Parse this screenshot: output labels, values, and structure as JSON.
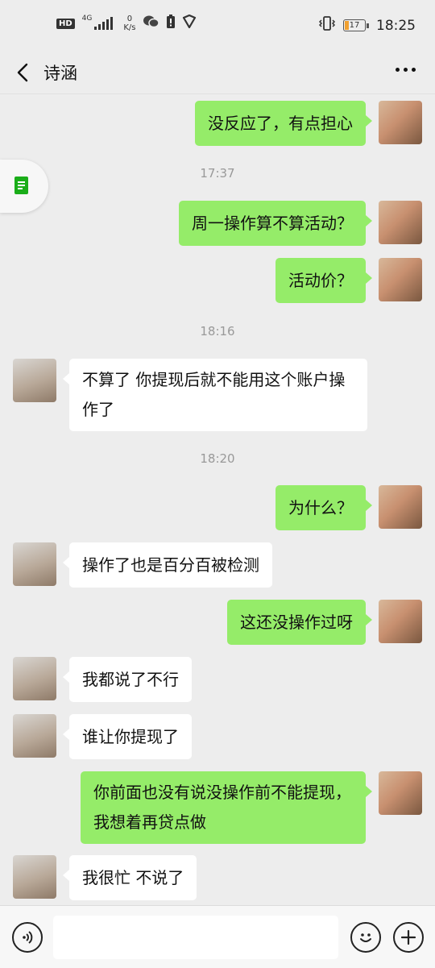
{
  "status_bar": {
    "hd": "HD",
    "network": "4G",
    "speed_value": "0",
    "speed_unit": "K/s",
    "battery": "17",
    "time": "18:25"
  },
  "header": {
    "title": "诗涵"
  },
  "messages": [
    {
      "from": "me",
      "text": "没反应了，有点担心"
    },
    {
      "time": "17:37"
    },
    {
      "from": "me",
      "text": "周一操作算不算活动？"
    },
    {
      "from": "me",
      "text": "活动价？"
    },
    {
      "time": "18:16"
    },
    {
      "from": "other",
      "text": "不算了 你提现后就不能用这个账户操作了"
    },
    {
      "time": "18:20"
    },
    {
      "from": "me",
      "text": "为什么？"
    },
    {
      "from": "other",
      "text": "操作了也是百分百被检测"
    },
    {
      "from": "me",
      "text": "这还没操作过呀"
    },
    {
      "from": "other",
      "text": "我都说了不行"
    },
    {
      "from": "other",
      "text": "谁让你提现了"
    },
    {
      "from": "me",
      "text": "你前面也没有说没操作前不能提现，我想着再贷点做"
    },
    {
      "from": "other",
      "text": "我很忙 不说了"
    }
  ],
  "input": {
    "value": "",
    "placeholder": ""
  },
  "icons": {
    "back": "chevron-left-icon",
    "more": "more-dots-icon",
    "voice": "voice-icon",
    "emoji": "emoji-icon",
    "plus": "plus-icon",
    "floating": "document-icon"
  },
  "colors": {
    "my_bubble": "#95ec69",
    "other_bubble": "#ffffff",
    "background": "#ededed"
  }
}
